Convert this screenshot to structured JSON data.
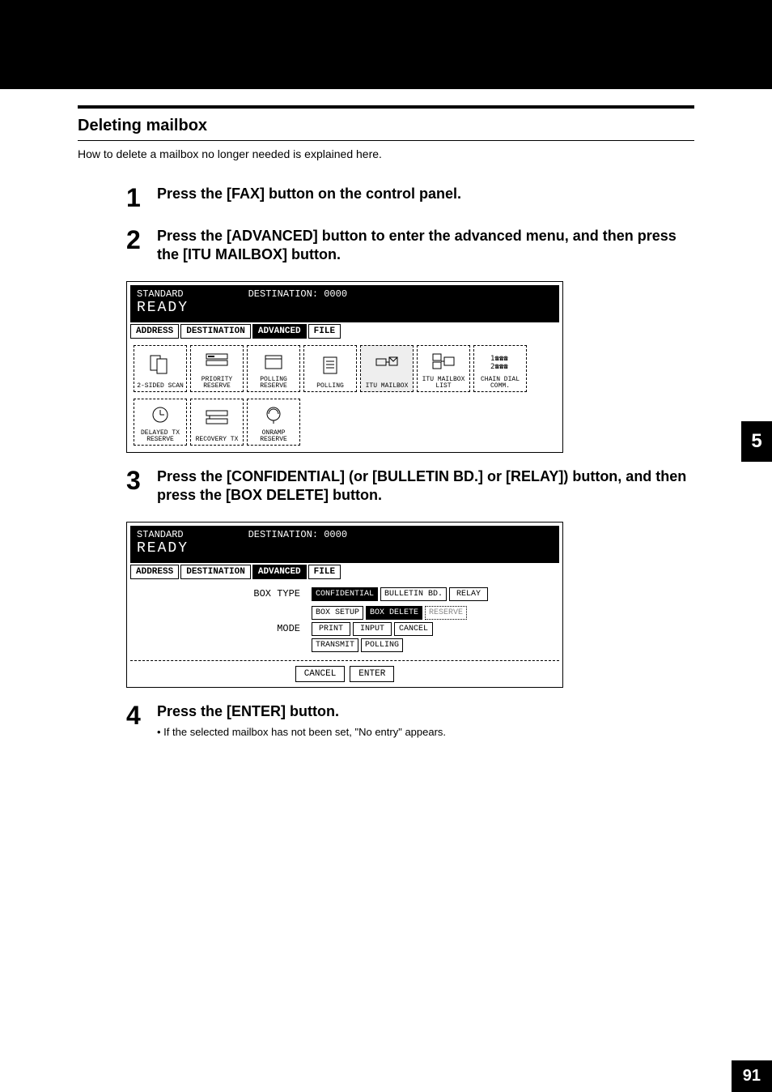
{
  "page": {
    "chapter_tab": "5",
    "page_number": "91",
    "section_title": "Deleting mailbox",
    "intro": "How to delete a mailbox no longer needed is explained here."
  },
  "steps": {
    "s1": {
      "num": "1",
      "text": "Press the [FAX] button on the control panel."
    },
    "s2": {
      "num": "2",
      "text": "Press the [ADVANCED] button to enter the advanced menu, and then press the [ITU MAILBOX] button."
    },
    "s3": {
      "num": "3",
      "text": "Press the [CONFIDENTIAL] (or [BULLETIN BD.] or [RELAY]) button, and then press the [BOX DELETE] button."
    },
    "s4": {
      "num": "4",
      "text": "Press the [ENTER] button.",
      "bullet": "If the selected mailbox has not been set, \"No entry\" appears."
    }
  },
  "screen1": {
    "status": "STANDARD",
    "dest": "DESTINATION: 0000",
    "ready": "READY",
    "tabs": {
      "address": "ADDRESS",
      "destination": "DESTINATION",
      "advanced": "ADVANCED",
      "file": "FILE"
    },
    "icons": {
      "two_sided": "2-SIDED SCAN",
      "priority": "PRIORITY RESERVE",
      "polling_res": "POLLING RESERVE",
      "polling": "POLLING",
      "itu_mailbox": "ITU MAILBOX",
      "itu_mailbox_list": "ITU MAILBOX LIST",
      "chain_dial": "CHAIN DIAL COMM.",
      "delayed_tx": "DELAYED TX RESERVE",
      "recovery": "RECOVERY TX",
      "onramp": "ONRAMP RESERVE"
    }
  },
  "screen2": {
    "status": "STANDARD",
    "dest": "DESTINATION: 0000",
    "ready": "READY",
    "tabs": {
      "address": "ADDRESS",
      "destination": "DESTINATION",
      "advanced": "ADVANCED",
      "file": "FILE"
    },
    "labels": {
      "box_type": "BOX TYPE",
      "mode": "MODE"
    },
    "box_type": {
      "confidential": "CONFIDENTIAL",
      "bulletin": "BULLETIN BD.",
      "relay": "RELAY"
    },
    "mode": {
      "box_setup": "BOX SETUP",
      "box_delete": "BOX DELETE",
      "f_code_nw": "RESERVE",
      "print": "PRINT",
      "input": "INPUT",
      "cancel": "CANCEL",
      "transmit": "TRANSMIT",
      "polling": "POLLING"
    },
    "bottom": {
      "cancel": "CANCEL",
      "enter": "ENTER"
    }
  }
}
